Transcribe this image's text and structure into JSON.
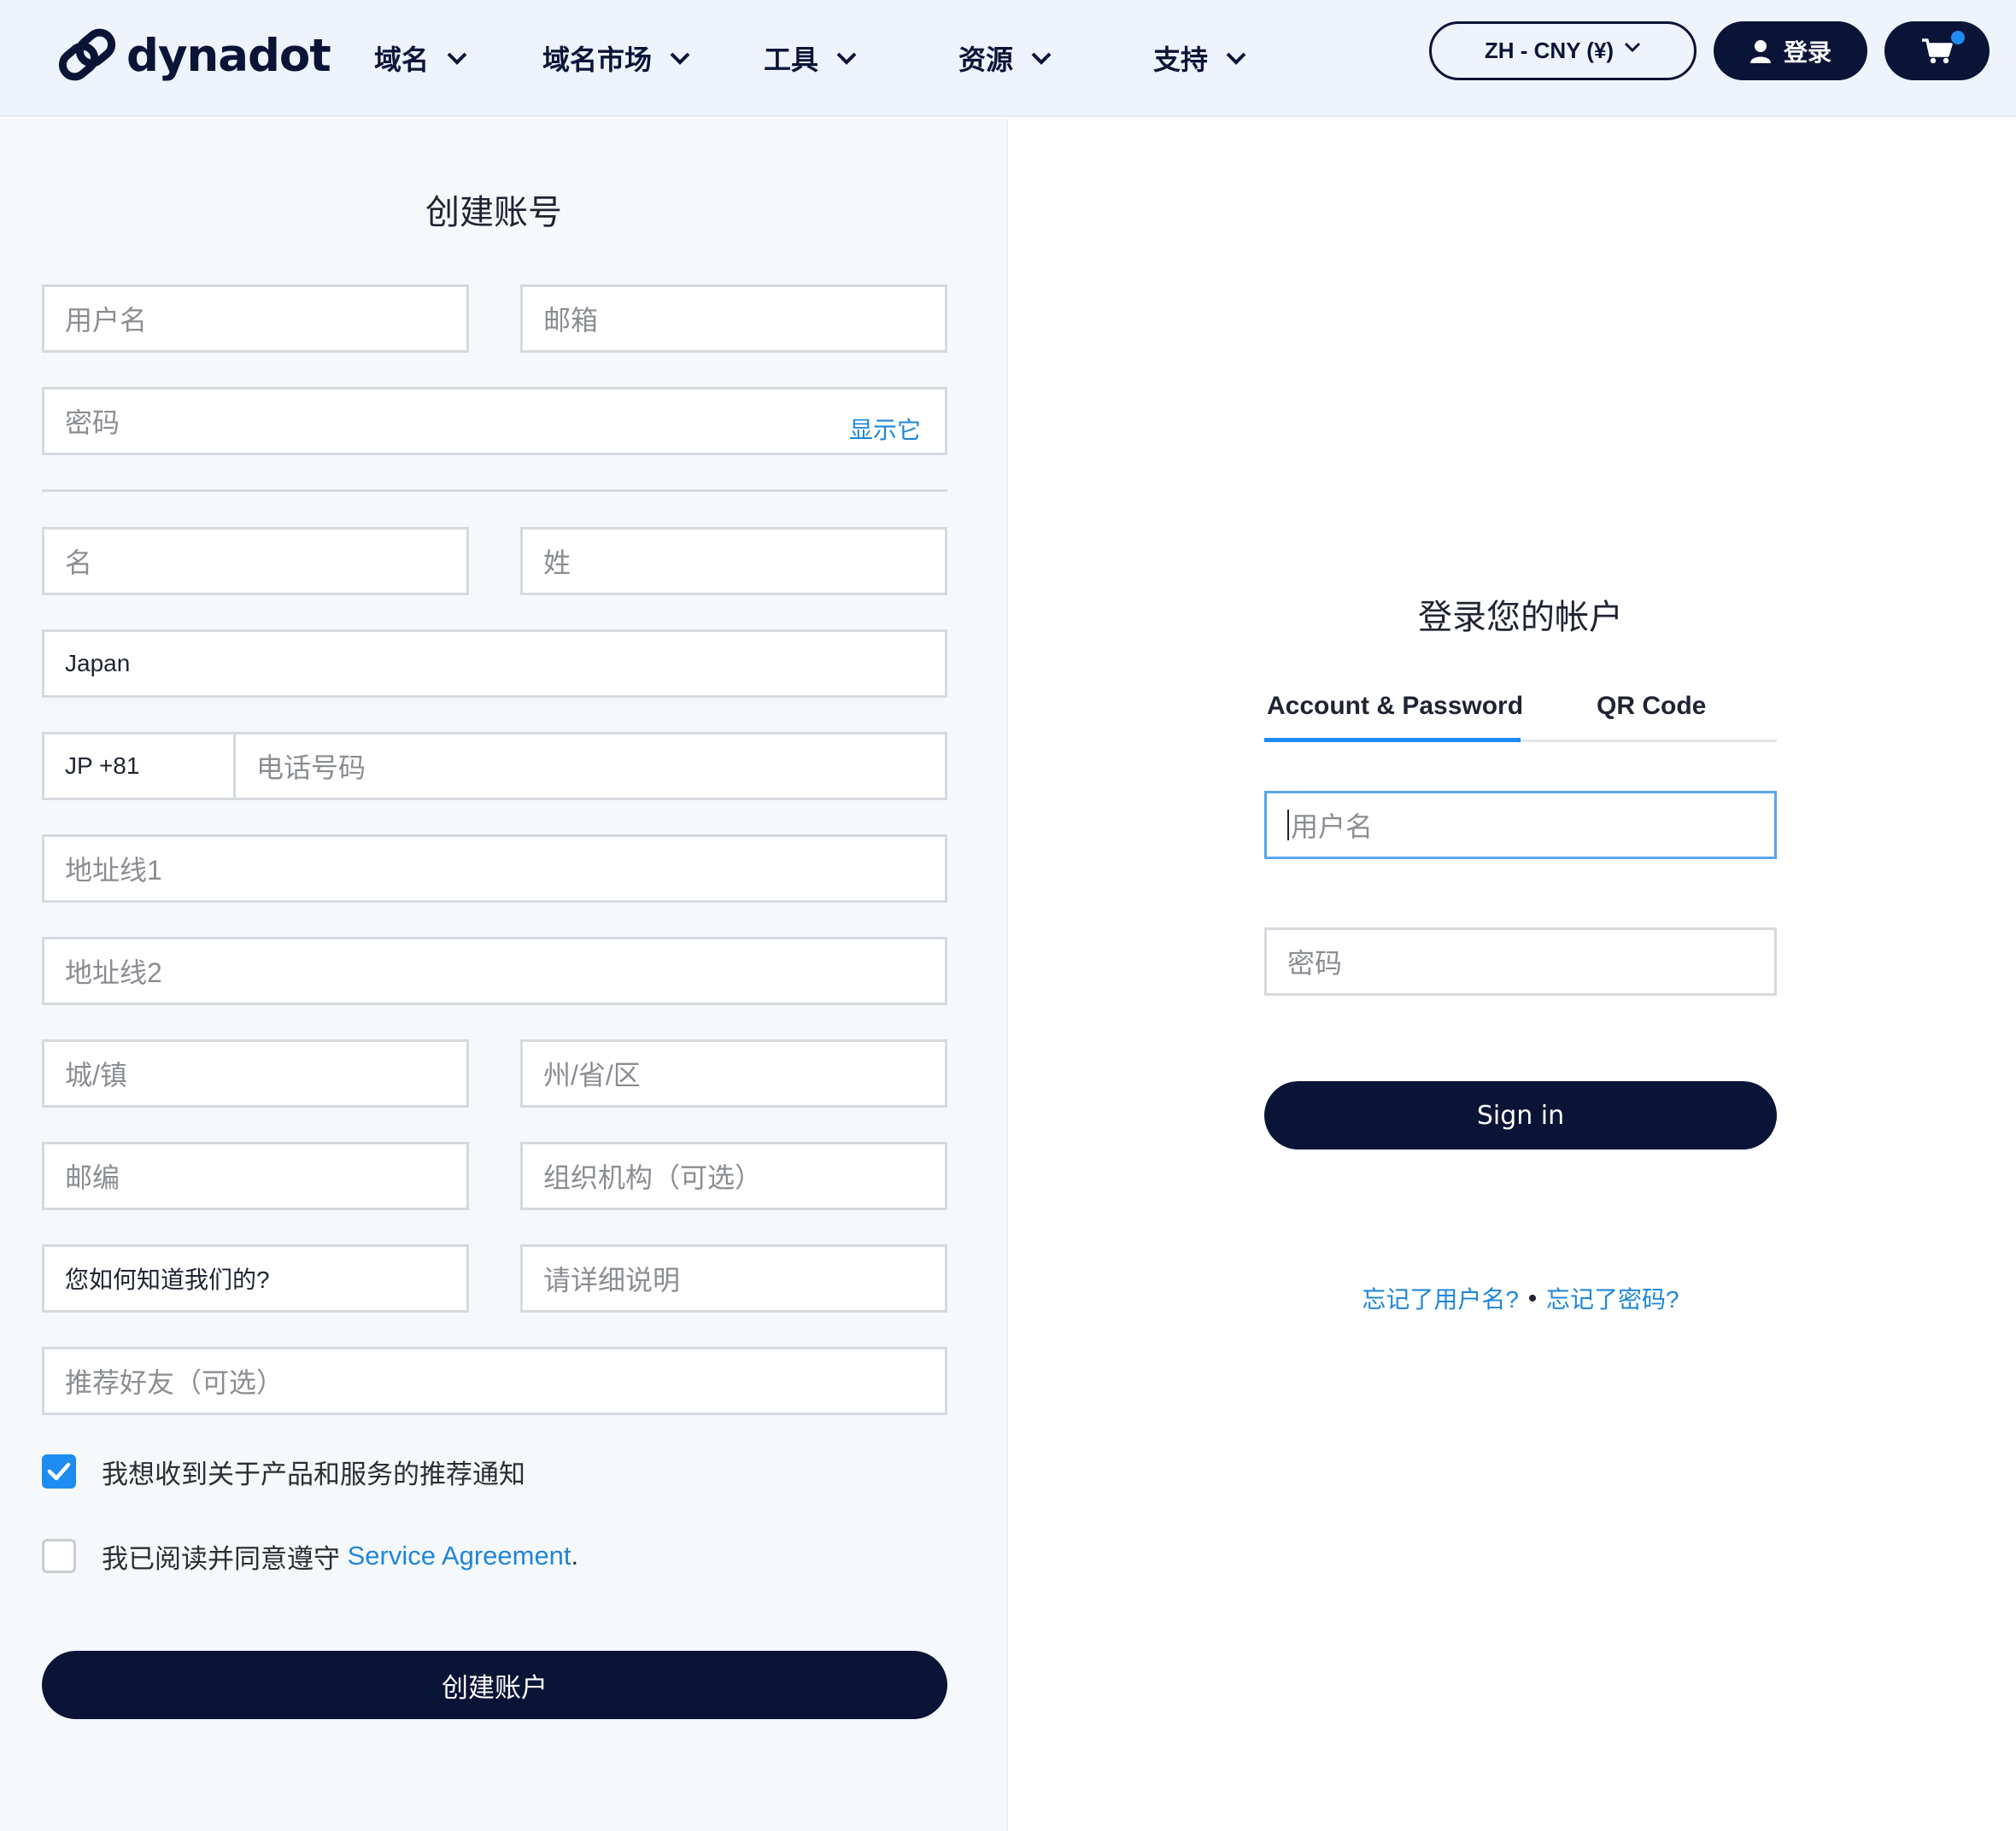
{
  "header": {
    "brand": "dynadot",
    "nav": [
      "域名",
      "域名市场",
      "工具",
      "资源",
      "支持"
    ],
    "language_currency": "ZH - CNY (¥)",
    "login_label": "登录",
    "icons": {
      "logo": "dynadot-logo-icon",
      "user": "user-icon",
      "cart": "cart-icon",
      "chevron": "chevron-down-icon"
    }
  },
  "signup": {
    "title": "创建账号",
    "username_placeholder": "用户名",
    "email_placeholder": "邮箱",
    "password_placeholder": "密码",
    "show_password": "显示它",
    "first_name_placeholder": "名",
    "last_name_placeholder": "姓",
    "country_value": "Japan",
    "phone_code_value": "JP +81",
    "phone_placeholder": "电话号码",
    "address1_placeholder": "地址线1",
    "address2_placeholder": "地址线2",
    "city_placeholder": "城/镇",
    "state_placeholder": "州/省/区",
    "zip_placeholder": "邮编",
    "org_placeholder": "组织机构（可选）",
    "referral_source_value": "您如何知道我们的?",
    "details_placeholder": "请详细说明",
    "referrer_placeholder": "推荐好友（可选）",
    "newsletter_label": "我想收到关于产品和服务的推荐通知",
    "newsletter_checked": true,
    "agreement_prefix": "我已阅读并同意遵守 ",
    "agreement_link": "Service Agreement",
    "agreement_suffix": ".",
    "agreement_checked": false,
    "submit_label": "创建账户"
  },
  "signin": {
    "title": "登录您的帐户",
    "tabs": [
      "Account & Password",
      "QR Code"
    ],
    "active_tab": "Account & Password",
    "username_placeholder": "用户名",
    "password_placeholder": "密码",
    "submit_label": "Sign in",
    "forgot_username": "忘记了用户名?",
    "forgot_password": "忘记了密码?"
  },
  "colors": {
    "navy": "#0a1437",
    "accent": "#1e8cf0",
    "link": "#1f86d9",
    "panel_bg": "#f6f9fc",
    "header_bg": "#eef4fc"
  }
}
